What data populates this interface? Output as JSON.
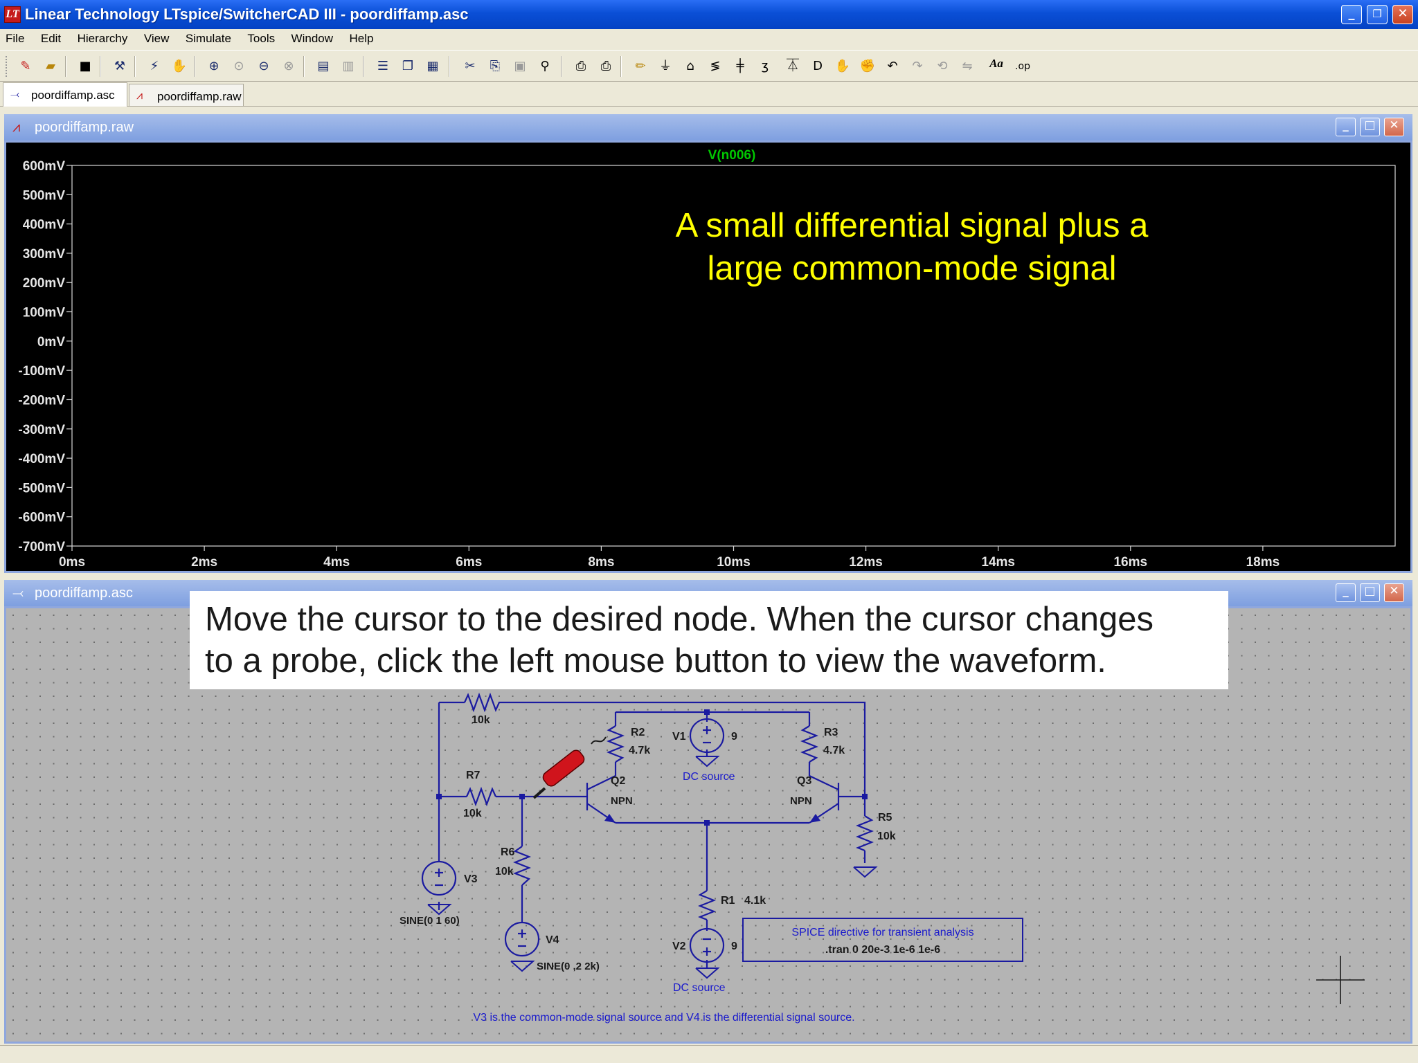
{
  "window": {
    "title": "Linear Technology LTspice/SwitcherCAD III - poordiffamp.asc",
    "minimize": "_",
    "restore": "❐",
    "close": "✕"
  },
  "menu": [
    "File",
    "Edit",
    "Hierarchy",
    "View",
    "Simulate",
    "Tools",
    "Window",
    "Help"
  ],
  "toolbar": {
    "icons": [
      "new-schematic-icon",
      "open-icon",
      "save-icon",
      "control-panel-icon",
      "run-icon",
      "halt-icon",
      "zoom-in-icon",
      "zoom-area-icon",
      "zoom-out-icon",
      "zoom-fit-icon",
      "autorange-icon",
      "mark-unref-icon",
      "tile-horizontal-icon",
      "cascade-icon",
      "tile-vertical-icon",
      "cut-icon",
      "copy-icon",
      "paste-icon",
      "find-icon",
      "print-setup-icon",
      "print-icon",
      "wire-icon",
      "ground-icon",
      "label-net-icon",
      "resistor-icon",
      "capacitor-icon",
      "inductor-icon",
      "diode-icon",
      "component-icon",
      "move-icon",
      "drag-icon",
      "undo-icon",
      "redo-icon",
      "rotate-icon",
      "mirror-icon",
      "text-icon",
      "spice-directive-icon"
    ],
    "text_label": "Aa",
    "op_label": ".op"
  },
  "tabs": [
    {
      "label": "poordiffamp.asc",
      "active": true
    },
    {
      "label": "poordiffamp.raw",
      "active": false
    }
  ],
  "plot_window": {
    "title": "poordiffamp.raw",
    "trace_name": "V(n006)",
    "trace_color": "#00c800",
    "annotation_line1": "A small differential signal plus a",
    "annotation_line2": "large common-mode signal",
    "annotation_color": "#ffff00"
  },
  "chart_data": {
    "type": "line",
    "title": "V(n006)",
    "series": [
      {
        "name": "V(n006)",
        "values": []
      }
    ],
    "x_ticks": [
      "0ms",
      "2ms",
      "4ms",
      "6ms",
      "8ms",
      "10ms",
      "12ms",
      "14ms",
      "16ms",
      "18ms"
    ],
    "y_ticks": [
      "600mV",
      "500mV",
      "400mV",
      "300mV",
      "200mV",
      "100mV",
      "0mV",
      "-100mV",
      "-200mV",
      "-300mV",
      "-400mV",
      "-500mV",
      "-600mV",
      "-700mV"
    ],
    "xlim": [
      0,
      20
    ],
    "ylim": [
      -700,
      600
    ],
    "x_unit": "ms",
    "y_unit": "mV",
    "background": "#000000",
    "grid": false
  },
  "schematic_window": {
    "title": "poordiffamp.asc",
    "instruction_line1": "Move the cursor to the desired node.  When the cursor changes",
    "instruction_line2": "to a probe, click the left mouse button to view the waveform."
  },
  "schematic": {
    "wire_color": "#1a1aa0",
    "label_color": "#1a1acc",
    "components": {
      "r_top": {
        "value": "10k"
      },
      "r7": {
        "name": "R7",
        "value": "10k"
      },
      "r6": {
        "name": "R6",
        "value": "10k"
      },
      "r2": {
        "name": "R2",
        "value": "4.7k"
      },
      "r3": {
        "name": "R3",
        "value": "4.7k"
      },
      "r5": {
        "name": "R5",
        "value": "10k"
      },
      "r1": {
        "name": "R1",
        "value": "4.1k"
      },
      "q2": {
        "name": "Q2",
        "model": "NPN"
      },
      "q3": {
        "name": "Q3",
        "model": "NPN"
      },
      "v1": {
        "name": "V1",
        "value": "9",
        "comment": "DC source"
      },
      "v2": {
        "name": "V2",
        "value": "9",
        "comment": "DC source"
      },
      "v3": {
        "name": "V3",
        "value": "SINE(0 1 60)"
      },
      "v4": {
        "name": "V4",
        "value": "SINE(0 ,2 2k)"
      }
    },
    "directive_title": "SPICE directive for transient analysis",
    "directive_text": ".tran 0 20e-3 1e-6 1e-6",
    "note": "V3 is the common-mode signal source and V4 is the differential signal source."
  }
}
